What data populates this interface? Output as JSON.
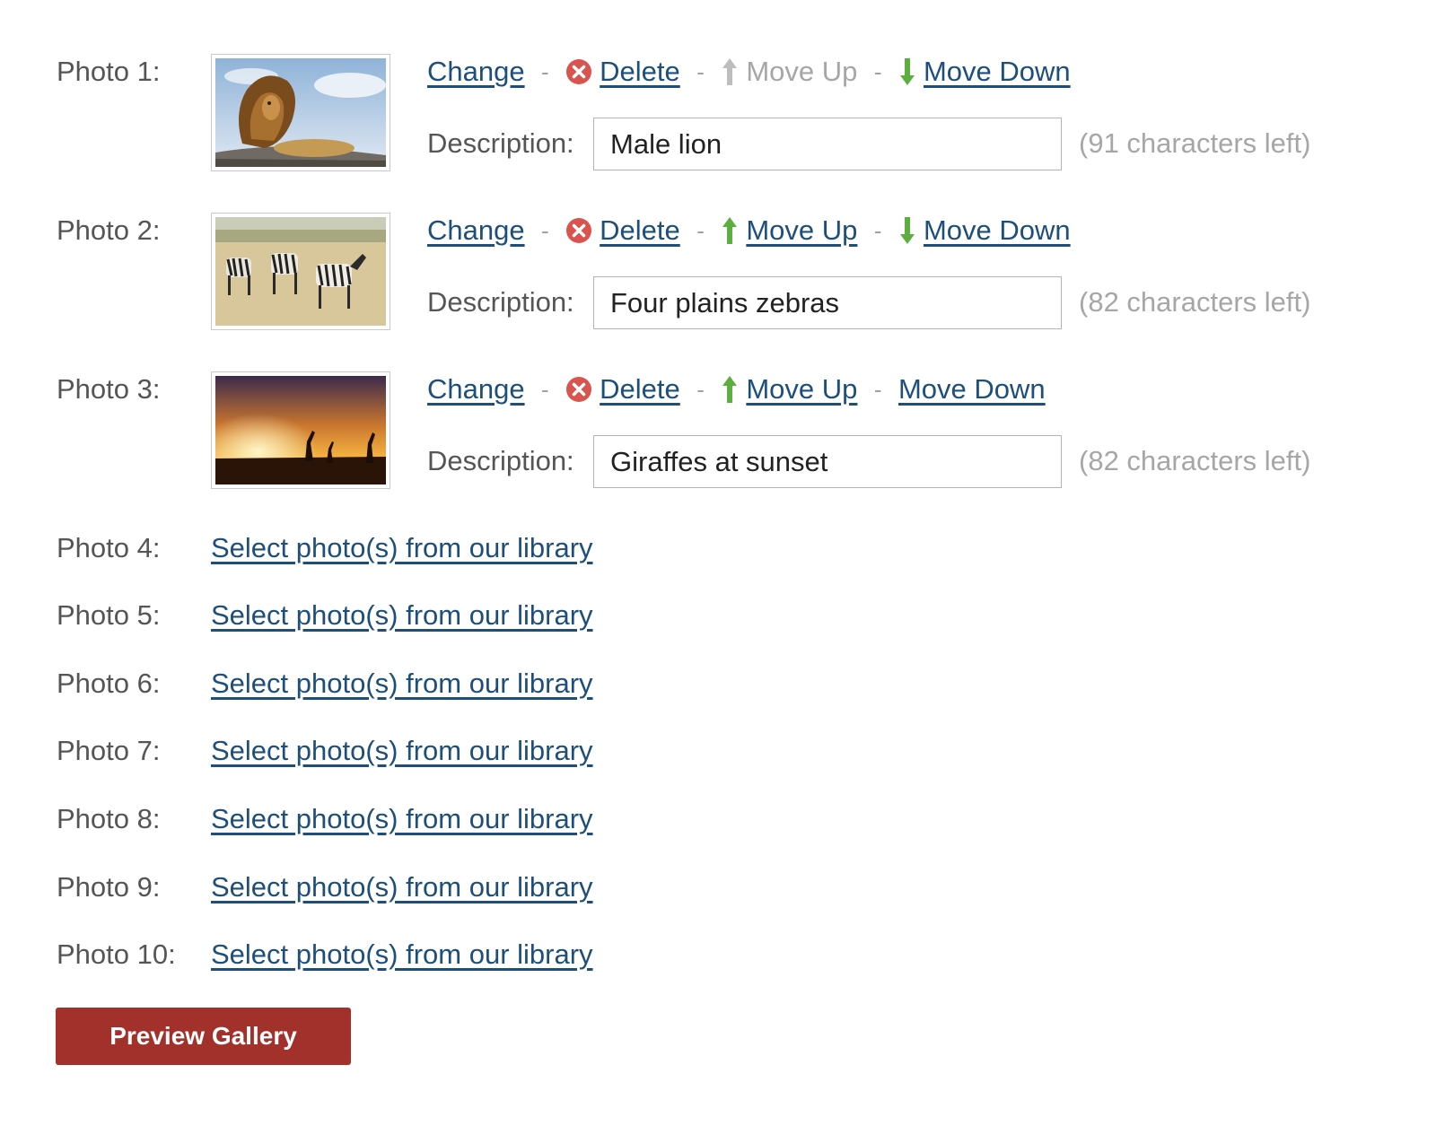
{
  "gallery": {
    "photos": [
      {
        "label": "Photo 1:",
        "thumbnail_subject": "lion",
        "change_label": "Change",
        "delete_label": "Delete",
        "move_up_label": "Move Up",
        "move_up_enabled": false,
        "move_down_label": "Move Down",
        "move_down_enabled": true,
        "description_label": "Description:",
        "description_value": "Male lion",
        "chars_left": "(91 characters left)"
      },
      {
        "label": "Photo 2:",
        "thumbnail_subject": "zebras",
        "change_label": "Change",
        "delete_label": "Delete",
        "move_up_label": "Move Up",
        "move_up_enabled": true,
        "move_down_label": "Move Down",
        "move_down_enabled": true,
        "description_label": "Description:",
        "description_value": "Four plains zebras",
        "chars_left": "(82 characters left)"
      },
      {
        "label": "Photo 3:",
        "thumbnail_subject": "giraffes-sunset",
        "change_label": "Change",
        "delete_label": "Delete",
        "move_up_label": "Move Up",
        "move_up_enabled": true,
        "move_down_label": "Move Down",
        "move_down_enabled": true,
        "description_label": "Description:",
        "description_value": "Giraffes at sunset",
        "chars_left": "(82 characters left)"
      }
    ],
    "separator": "-",
    "empty_slots": [
      {
        "label": "Photo 4:",
        "link": "Select photo(s) from our library"
      },
      {
        "label": "Photo 5:",
        "link": "Select photo(s) from our library"
      },
      {
        "label": "Photo 6:",
        "link": "Select photo(s) from our library"
      },
      {
        "label": "Photo 7:",
        "link": "Select photo(s) from our library"
      },
      {
        "label": "Photo 8:",
        "link": "Select photo(s) from our library"
      },
      {
        "label": "Photo 9:",
        "link": "Select photo(s) from our library"
      },
      {
        "label": "Photo 10:",
        "link": "Select photo(s) from our library"
      }
    ],
    "preview_button": "Preview Gallery"
  },
  "colors": {
    "link": "#1d4f7a",
    "button": "#a3312b",
    "delete_icon": "#d9534f",
    "arrow_green": "#5cae3f",
    "arrow_disabled": "#bdbdbd"
  },
  "icons": {
    "delete": "delete-x-icon",
    "move_up": "arrow-up-icon",
    "move_down": "arrow-down-icon"
  }
}
